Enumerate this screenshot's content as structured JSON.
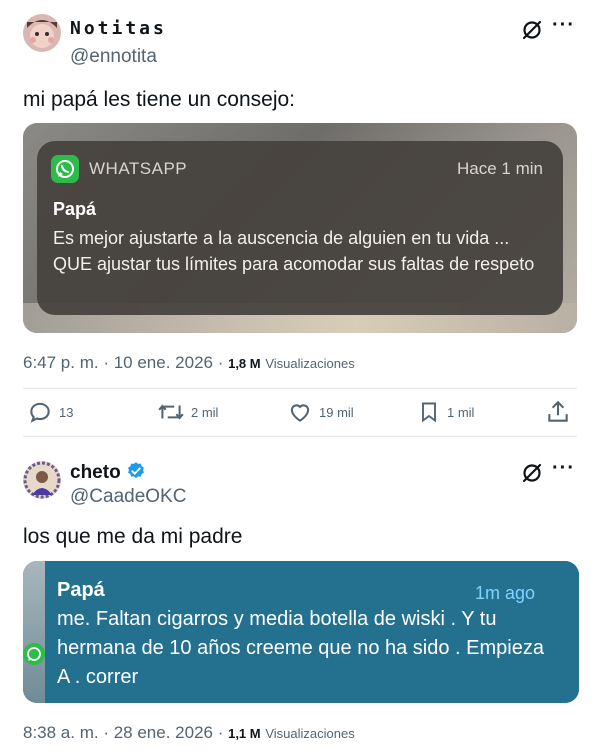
{
  "tweet1": {
    "display_name": "Notitas",
    "handle": "@ennotita",
    "text": "mi papá les tiene un consejo:",
    "notification": {
      "app": "WHATSAPP",
      "time": "Hace 1 min",
      "sender": "Papá",
      "message": "Es mejor ajustarte a la auscencia de alguien en tu vida ... QUE ajustar tus límites para acomodar sus faltas de respeto"
    },
    "time": "6:47 p. m.",
    "date": "10 ene. 2026",
    "views_count": "1,8 M",
    "views_label": "Visualizaciones",
    "replies": "13",
    "reposts": "2 mil",
    "likes": "19 mil",
    "bookmarks": "1 mil"
  },
  "tweet2": {
    "display_name": "cheto",
    "handle": "@CaadeOKC",
    "text": "los que me da mi padre",
    "message": {
      "sender": "Papá",
      "time": "1m ago",
      "body": "me. Faltan cigarros y media botella de wiski . Y tu hermana de 10 años creeme que no ha sido . Empieza A . correr"
    },
    "time": "8:38 a. m.",
    "date": "28 ene. 2026",
    "views_count": "1,1 M",
    "views_label": "Visualizaciones"
  },
  "colors": {
    "secondary_text": "#536471",
    "verified_blue": "#1d9bf0",
    "whatsapp_green": "#2dbb4a",
    "notification_bg": "#46423e",
    "bubble_bg": "#24718f"
  },
  "icons": [
    "grok-icon",
    "more-icon",
    "verified-badge-icon",
    "reply-icon",
    "repost-icon",
    "like-icon",
    "bookmark-icon",
    "share-icon",
    "whatsapp-icon"
  ]
}
